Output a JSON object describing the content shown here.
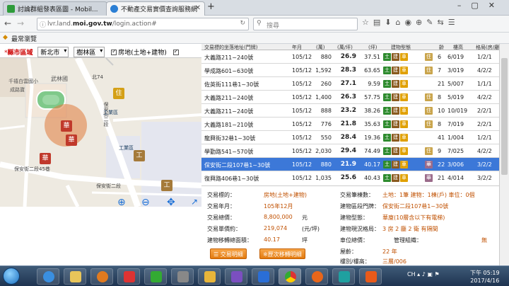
{
  "tabs": [
    {
      "title": "討論群組發表區圖 - Mobil...",
      "fav_color": "#2e9b3a"
    },
    {
      "title": "不動產交易實價查詢服務網",
      "fav_color": "#2c7fd4"
    }
  ],
  "nav": {
    "url_plain": "lvr.land.",
    "url_bold": "moi.gov.tw",
    "url_rest": "/login.action#",
    "search_placeholder": "搜尋"
  },
  "bookmarks": {
    "label": "最常瀏覽"
  },
  "filter": {
    "area_label": "縣市區域",
    "city": "新北市",
    "district": "樹林區",
    "opt1": "房地(土地+建物)"
  },
  "map": {
    "place_wulin": "武林國",
    "road_baoan": "保安街二段",
    "road_baoan45": "保安街二段45巷",
    "road_north74": "北74",
    "label_gongye1": "工業區",
    "label_gongye2": "工業區",
    "place_hua1": "華",
    "place_hua2": "華",
    "place_hua3": "華",
    "place_zhu": "住",
    "place_gong1": "工",
    "place_gong2": "工",
    "place_qian": "千禧白雲國小",
    "place_zhu2": "成路寶"
  },
  "list": {
    "header": [
      "交易標的坐落地址(門牌)",
      "年月",
      "(萬)",
      "(萬/坪)",
      "(坪)",
      "建物型態",
      "",
      "齡",
      "樓高",
      "格局(房/廳/衛)"
    ],
    "rows": [
      {
        "addr": "大義路211~240號",
        "ym": "105/12",
        "total": "880",
        "unit": "26.9",
        "area": "37.51",
        "tag": "住",
        "age": "6",
        "floor": "6/019",
        "layout": "1/2/1"
      },
      {
        "addr": "學成路601~630號",
        "ym": "105/12",
        "total": "1,592",
        "unit": "28.3",
        "area": "63.65",
        "tag": "住",
        "age": "7",
        "floor": "3/019",
        "layout": "4/2/2"
      },
      {
        "addr": "佐英街111巷1~30號",
        "ym": "105/12",
        "total": "260",
        "unit": "27.1",
        "area": "9.59",
        "tag": "",
        "age": "21",
        "floor": "5/007",
        "layout": "1/1/1"
      },
      {
        "addr": "大義路211~240號",
        "ym": "105/12",
        "total": "1,400",
        "unit": "26.3",
        "area": "57.75",
        "tag": "住",
        "age": "8",
        "floor": "5/019",
        "layout": "4/2/2"
      },
      {
        "addr": "大義路211~240號",
        "ym": "105/12",
        "total": "888",
        "unit": "23.2",
        "area": "38.26",
        "tag": "住",
        "age": "10",
        "floor": "10/019",
        "layout": "2/2/1"
      },
      {
        "addr": "大義路181~210號",
        "ym": "105/12",
        "total": "776",
        "unit": "21.8",
        "area": "35.63",
        "tag": "住",
        "age": "8",
        "floor": "7/019",
        "layout": "2/2/1"
      },
      {
        "addr": "龍興街32巷1~30號",
        "ym": "105/12",
        "total": "550",
        "unit": "28.4",
        "area": "19.36",
        "tag": "",
        "age": "41",
        "floor": "1/004",
        "layout": "1/2/1"
      },
      {
        "addr": "學勤路541~570號",
        "ym": "105/12",
        "total": "2,030",
        "unit": "29.4",
        "area": "74.49",
        "tag": "住",
        "age": "9",
        "floor": "7/025",
        "layout": "4/2/2"
      },
      {
        "addr": "保安街二段107巷1~30號",
        "ym": "105/12",
        "total": "880",
        "unit": "21.9",
        "area": "40.17",
        "tag": "華",
        "age": "22",
        "floor": "3/006",
        "layout": "3/2/2",
        "selected": true
      },
      {
        "addr": "復興路406巷1~30號",
        "ym": "105/12",
        "total": "1,035",
        "unit": "25.6",
        "area": "40.43",
        "tag": "華",
        "age": "21",
        "floor": "4/014",
        "layout": "3/2/2"
      }
    ],
    "badge_land": "土",
    "badge_bld": "建",
    "badge_park": "車"
  },
  "detail": {
    "l1k": "交易標的：",
    "l1v": "房地(土地+建物)",
    "l2k": "交易年月：",
    "l2v": "105年12月",
    "l3k": "交易總價：",
    "l3v": "8,800,000",
    "l3u": "元",
    "l4k": "交易單價約：",
    "l4v": "219,074",
    "l4u": "(元/坪)",
    "l5k": "建物移轉總面積：",
    "l5v": "40.17",
    "l5u": "坪",
    "r1k": "交易筆棟數：",
    "r1v": "土地：1筆 建物：1棟(戶) 車位：0個",
    "r2k": "建物區段門牌：",
    "r2v": "保安街二段107巷1~30號",
    "r3k": "建物型態：",
    "r3v": "華廈(10層含以下有電梯)",
    "r4k": "建物現況格局：",
    "r4v": "3 房 2 廳 2 衛 有隔間",
    "r5k": "車位總價：",
    "r5k2": "管理組織：",
    "r5v": "無",
    "r6k": "屋齡：",
    "r6v": "22 年",
    "r7k": "樓別/樓高：",
    "r7v": "三層/006",
    "btn1": "交易明細",
    "btn2": "※歷次移轉明細"
  },
  "taskbar": {
    "lang": "CH",
    "time": "下午 05:19",
    "date": "2017/4/16"
  }
}
